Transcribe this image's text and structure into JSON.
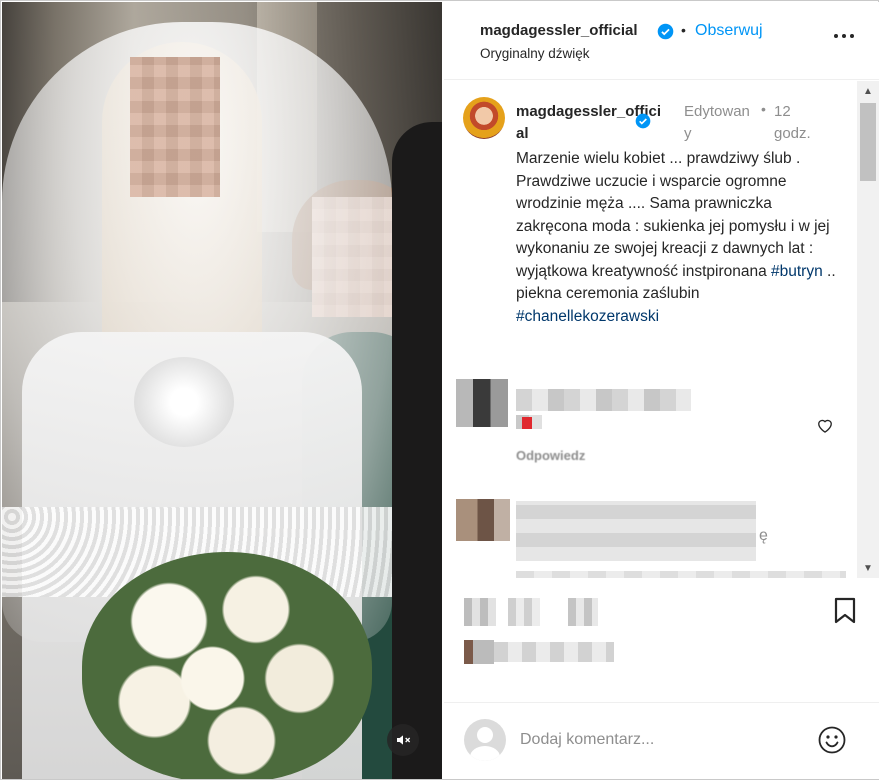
{
  "header": {
    "username": "magdagessler_official",
    "separator": "•",
    "follow_label": "Obserwuj",
    "audio_label": "Oryginalny dźwięk"
  },
  "caption": {
    "username": "magdagessler_official",
    "edited_label": "Edytowany",
    "separator": "•",
    "time_label": "12 godz.",
    "text_before": "Marzenie wielu kobiet ... prawdziwy ślub . Prawdziwe uczucie i wsparcie ogromne wrodzinie męża .... Sama prawniczka zakręcona moda : sukienka jej pomysłu i w jej wykonaniu ze swojej kreacji z dawnych lat : wyjątkowa kreatywność instpironana ",
    "hashtag_1": "#butryn",
    "text_middle": " .. piekna ceremonia zaślubin ",
    "hashtag_2": "#chanellekozerawski"
  },
  "comments": {
    "reply_label": "Odpowiedz",
    "trailing_char": "ę"
  },
  "add_comment": {
    "placeholder": "Dodaj komentarz..."
  },
  "icons": {
    "verified": "verified-badge-icon",
    "more": "more-horizontal-icon",
    "heart": "heart-icon",
    "bookmark": "bookmark-icon",
    "emoji": "emoji-smile-icon",
    "mute": "speaker-muted-icon"
  },
  "colors": {
    "link_blue": "#0095f6",
    "hashtag": "#00376b",
    "muted_text": "#8e8e8e",
    "verified": "#0095f6"
  }
}
